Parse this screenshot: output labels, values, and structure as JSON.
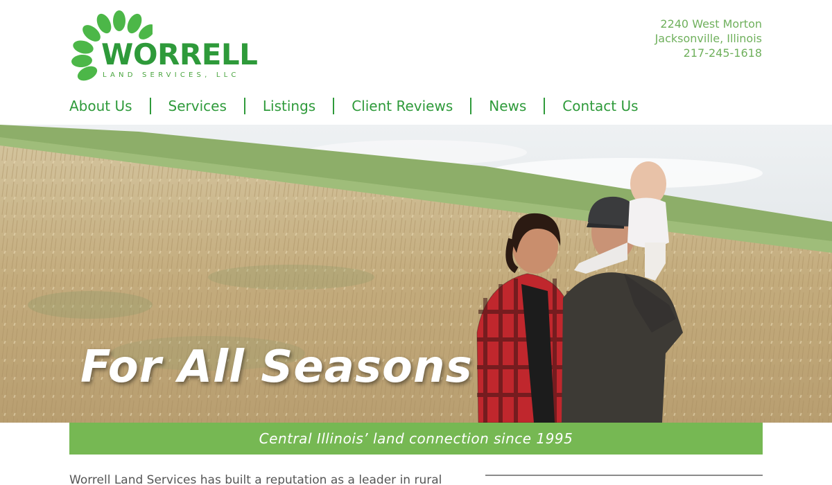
{
  "brand": {
    "name": "WORRELL",
    "subtitle": "LAND SERVICES, LLC",
    "color": "#2e9a3a",
    "leaf_color": "#4cb748"
  },
  "contact": {
    "street": "2240 West Morton",
    "city": "Jacksonville, Illinois",
    "phone": "217-245-1618"
  },
  "nav": {
    "items": [
      "About Us",
      "Services",
      "Listings",
      "Client Reviews",
      "News",
      "Contact Us"
    ]
  },
  "hero": {
    "title": "For All Seasons"
  },
  "tagline": {
    "text": "Central Illinois’ land connection since 1995",
    "background": "#76b853"
  },
  "intro": {
    "text": "Worrell Land Services has built a reputation as a leader in rural"
  }
}
